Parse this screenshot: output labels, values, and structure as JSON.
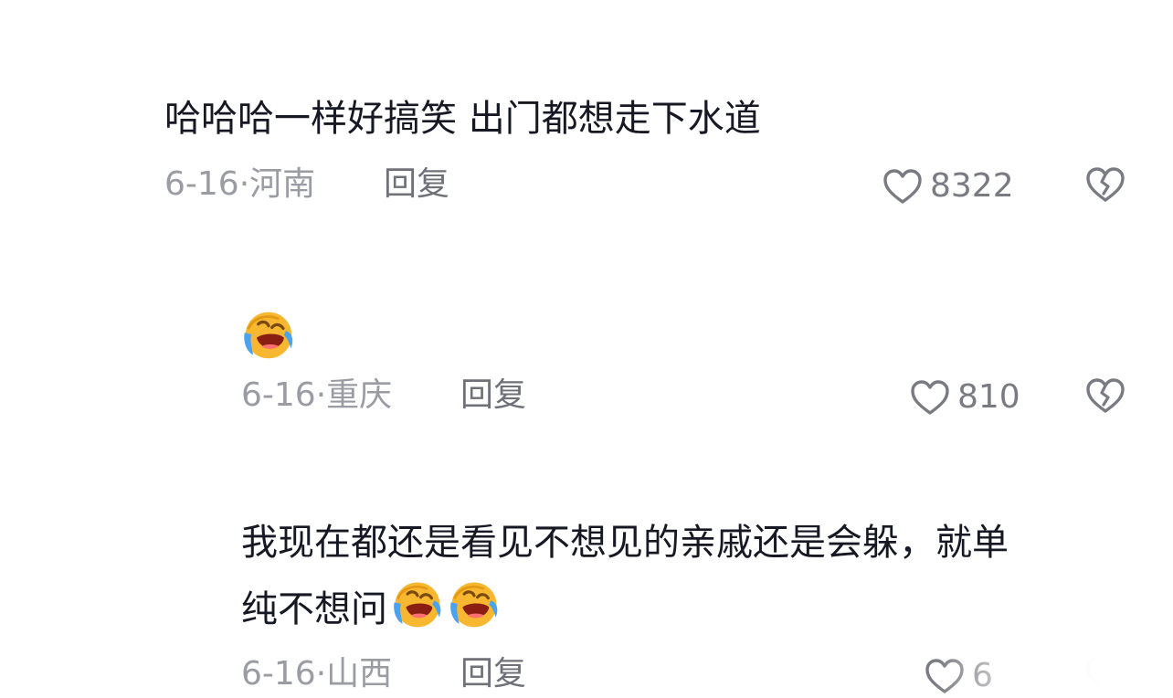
{
  "comments": [
    {
      "text": "哈哈哈一样好搞笑 出门都想走下水道",
      "date": "6-16",
      "location": "河南",
      "reply": "回复",
      "likes": "8322"
    },
    {
      "emoji": "crying-laughing-emoji",
      "date": "6-16",
      "location": "重庆",
      "reply": "回复",
      "likes": "810"
    },
    {
      "text_line1": "我现在都还是看见不想见的亲戚还是会躲，就单",
      "text_line2": "纯不想问",
      "emoji": "crying-laughing-emoji",
      "date": "6-16",
      "location": "山西",
      "reply": "回复",
      "likes": "6"
    }
  ],
  "icons": {
    "like": "heart-outline-icon",
    "dislike": "broken-heart-icon"
  },
  "colors": {
    "text": "#161823",
    "meta": "#9a9ba3",
    "reply": "#6f7078",
    "icon": "#7a7b82",
    "emoji_face": "#f7b731",
    "emoji_tear": "#4aa3f0"
  }
}
